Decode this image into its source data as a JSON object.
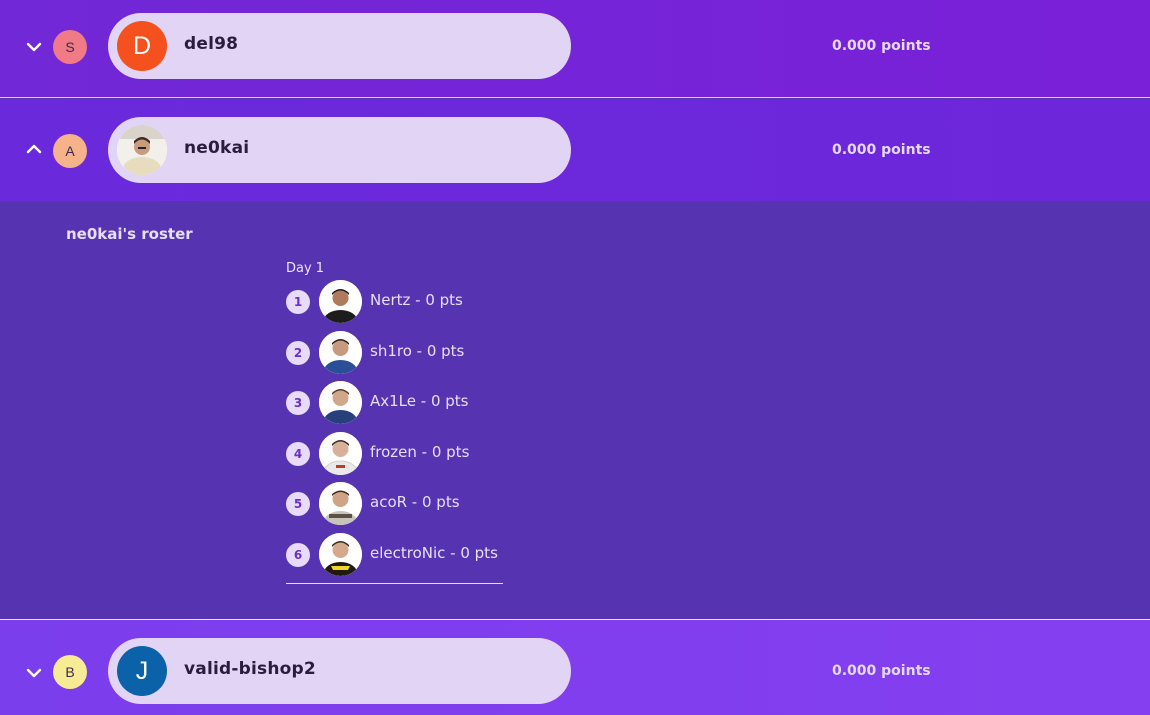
{
  "rows": [
    {
      "badge_letter": "S",
      "badge_color": "#f07a86",
      "avatar_letter": "D",
      "avatar_color": "#f4511e",
      "username": "del98",
      "points": "0.000 points",
      "expanded": false,
      "chevron_icon": "chevron-down-icon"
    },
    {
      "badge_letter": "A",
      "badge_color": "#f6b28a",
      "avatar_letter": "",
      "avatar_color": "#ffffff",
      "username": "ne0kai",
      "points": "0.000 points",
      "expanded": true,
      "chevron_icon": "chevron-up-icon"
    },
    {
      "badge_letter": "B",
      "badge_color": "#f7ec93",
      "avatar_letter": "J",
      "avatar_color": "#0b62a8",
      "username": "valid-bishop2",
      "points": "0.000 points",
      "expanded": false,
      "chevron_icon": "chevron-down-icon"
    }
  ],
  "roster": {
    "title": "ne0kai's roster",
    "day_label": "Day 1",
    "players": [
      {
        "num": "1",
        "label": "Nertz - 0 pts",
        "jersey_color": "#1d1d1d"
      },
      {
        "num": "2",
        "label": "sh1ro - 0 pts",
        "jersey_color": "#2a4f96"
      },
      {
        "num": "3",
        "label": "Ax1Le - 0 pts",
        "jersey_color": "#27407c"
      },
      {
        "num": "4",
        "label": "frozen - 0 pts",
        "jersey_color": "#e9e9e9"
      },
      {
        "num": "5",
        "label": "acoR - 0 pts",
        "jersey_color": "#c9c4b8"
      },
      {
        "num": "6",
        "label": "electroNic - 0 pts",
        "jersey_color": "#1f1a0c"
      }
    ]
  },
  "colors": {
    "pill_bg": "#e2d4f5",
    "panel_bg": "#5634b1",
    "accent_text": "#e4d9f7"
  }
}
